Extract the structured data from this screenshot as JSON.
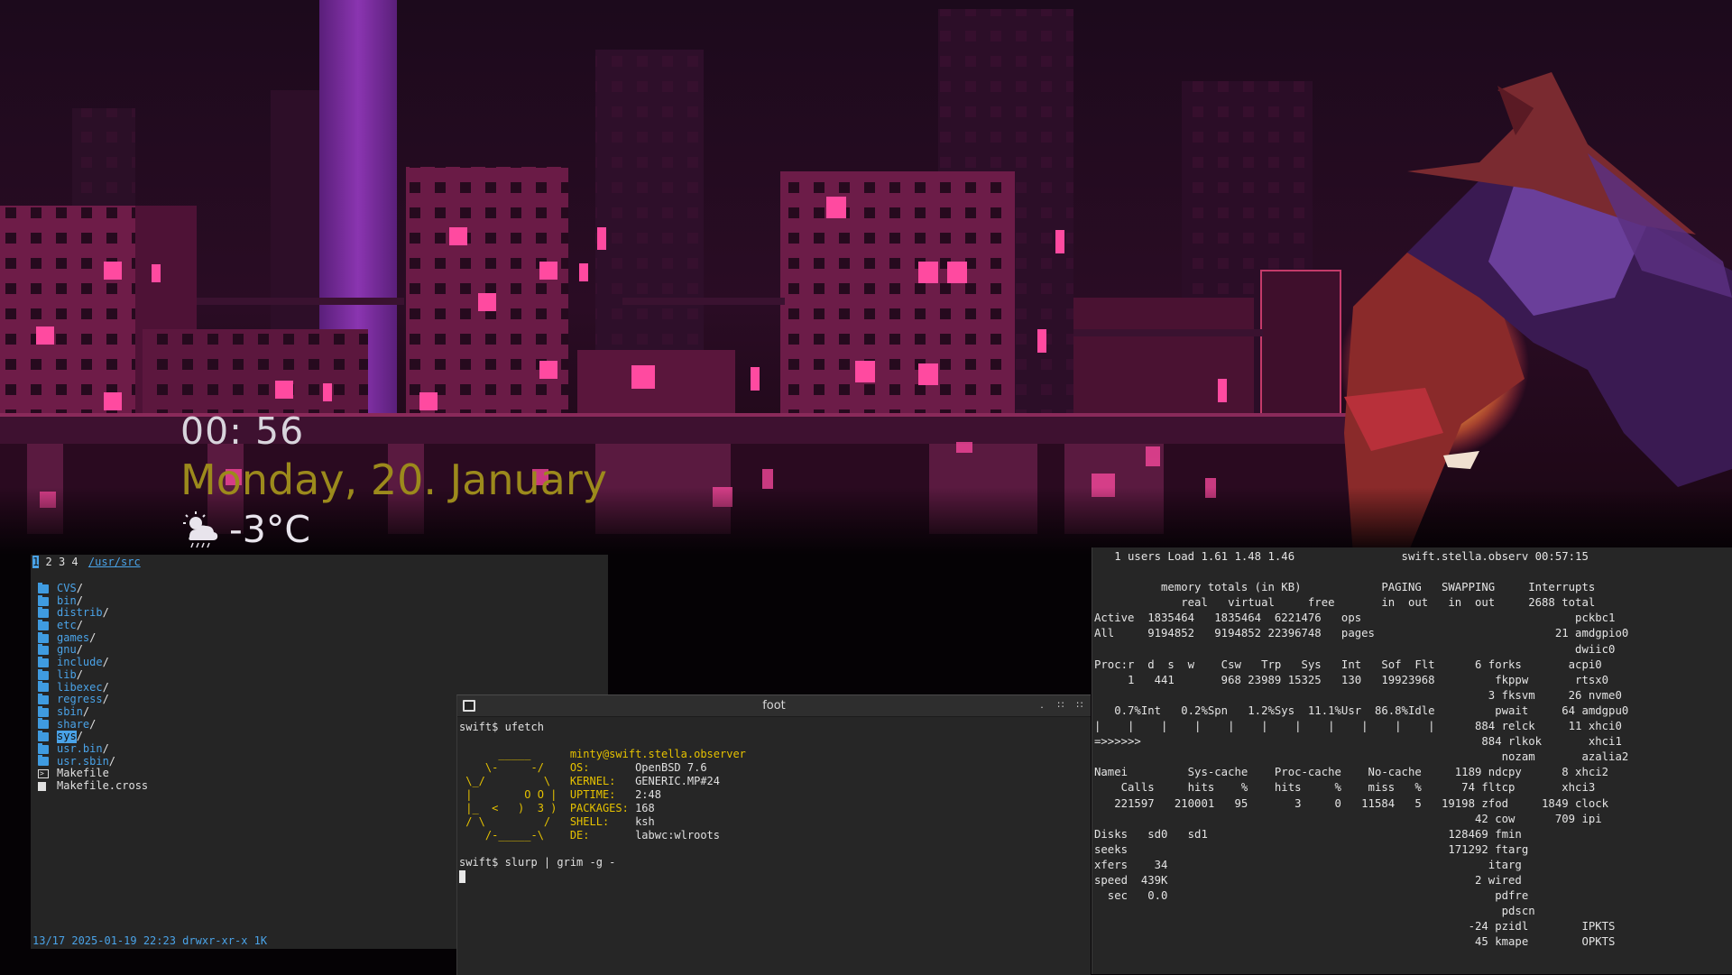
{
  "clock": {
    "time": "00: 56",
    "date": "Monday, 20. January",
    "weather_icon": "cloud-sun-rain-icon",
    "temperature": "-3°C"
  },
  "file_manager": {
    "contexts": [
      "1",
      "2",
      "3",
      "4"
    ],
    "active_context": "1",
    "path": "/usr/src",
    "entries": [
      {
        "name": "CVS",
        "suffix": "/",
        "type": "dir"
      },
      {
        "name": "bin",
        "suffix": "/",
        "type": "dir"
      },
      {
        "name": "distrib",
        "suffix": "/",
        "type": "dir"
      },
      {
        "name": "etc",
        "suffix": "/",
        "type": "dir"
      },
      {
        "name": "games",
        "suffix": "/",
        "type": "dir"
      },
      {
        "name": "gnu",
        "suffix": "/",
        "type": "dir"
      },
      {
        "name": "include",
        "suffix": "/",
        "type": "dir"
      },
      {
        "name": "lib",
        "suffix": "/",
        "type": "dir"
      },
      {
        "name": "libexec",
        "suffix": "/",
        "type": "dir"
      },
      {
        "name": "regress",
        "suffix": "/",
        "type": "dir"
      },
      {
        "name": "sbin",
        "suffix": "/",
        "type": "dir"
      },
      {
        "name": "share",
        "suffix": "/",
        "type": "dir"
      },
      {
        "name": "sys",
        "suffix": "/",
        "type": "dir",
        "selected": true
      },
      {
        "name": "usr.bin",
        "suffix": "/",
        "type": "dir"
      },
      {
        "name": "usr.sbin",
        "suffix": "/",
        "type": "dir"
      },
      {
        "name": "Makefile",
        "suffix": "",
        "type": "exe"
      },
      {
        "name": "Makefile.cross",
        "suffix": "",
        "type": "file"
      }
    ],
    "status": "13/17 2025-01-19 22:23 drwxr-xr-x 1K"
  },
  "terminal": {
    "title": "foot",
    "prompt1": "swift$ ufetch",
    "user_host": "minty@swift.stella.observer",
    "logo": [
      "      _____",
      "    \\-     -/",
      " \\_/         \\",
      " |        O O |",
      " |_  <   )  3 )",
      " / \\         /",
      "    /-_____-\\"
    ],
    "info": [
      {
        "key": "OS:",
        "value": "OpenBSD 7.6"
      },
      {
        "key": "KERNEL:",
        "value": "GENERIC.MP#24"
      },
      {
        "key": "UPTIME:",
        "value": "2:48"
      },
      {
        "key": "PACKAGES:",
        "value": "168"
      },
      {
        "key": "SHELL:",
        "value": "ksh"
      },
      {
        "key": "DE:",
        "value": "labwc:wlroots"
      }
    ],
    "prompt2": "swift$ slurp | grim -g -"
  },
  "systat": {
    "lines": [
      "   1 users Load 1.61 1.48 1.46                swift.stella.observ 00:57:15",
      "",
      "          memory totals (in KB)            PAGING   SWAPPING     Interrupts",
      "             real   virtual     free       in  out   in  out     2688 total",
      "Active  1835464   1835464  6221476   ops                                pckbc1",
      "All     9194852   9194852 22396748   pages                           21 amdgpio0",
      "                                                                        dwiic0",
      "Proc:r  d  s  w    Csw   Trp   Sys   Int   Sof  Flt      6 forks       acpi0",
      "     1   441       968 23989 15325   130   19923968         fkppw       rtsx0",
      "                                                           3 fksvm     26 nvme0",
      "   0.7%Int   0.2%Spn   1.2%Sys  11.1%Usr  86.8%Idle         pwait     64 amdgpu0",
      "|    |    |    |    |    |    |    |    |    |    |      884 relck     11 xhci0",
      "=>>>>>>                                                   884 rlkok       xhci1",
      "                                                             nozam       azalia2",
      "Namei         Sys-cache    Proc-cache    No-cache     1189 ndcpy      8 xhci2",
      "    Calls     hits    %    hits     %    miss   %      74 fltcp       xhci3",
      "   221597   210001   95       3     0   11584   5   19198 zfod     1849 clock",
      "                                                         42 cow      709 ipi",
      "Disks   sd0   sd1                                    128469 fmin",
      "seeks                                                171292 ftarg",
      "xfers    34                                                itarg",
      "speed  439K                                              2 wired",
      "  sec   0.0                                                 pdfre",
      "                                                             pdscn",
      "                                                        -24 pzidl        IPKTS",
      "                                                         45 kmape        OPKTS"
    ]
  }
}
